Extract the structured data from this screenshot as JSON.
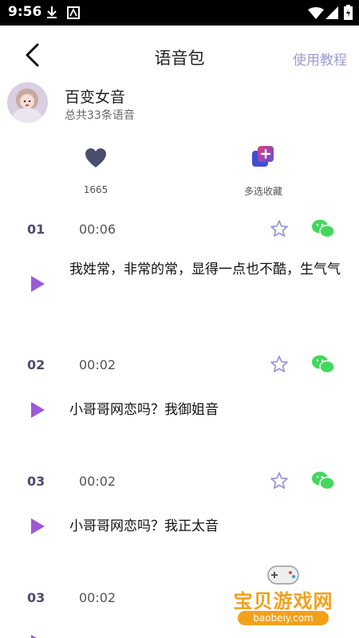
{
  "status_bar": {
    "time": "9:56"
  },
  "app_bar": {
    "title": "语音包",
    "tutorial_link": "使用教程"
  },
  "profile": {
    "name": "百变女音",
    "count_text": "总共33条语音"
  },
  "actions": {
    "likes_count": "1665",
    "multi_collect_label": "多选收藏"
  },
  "items": [
    {
      "number": "01",
      "duration": "00:06",
      "text": "我姓常，非常的常，显得一点也不酷，生气气"
    },
    {
      "number": "02",
      "duration": "00:02",
      "text": "小哥哥网恋吗？我御姐音"
    },
    {
      "number": "03",
      "duration": "00:02",
      "text": "小哥哥网恋吗？我正太音"
    },
    {
      "number": "03",
      "duration": "00:02",
      "text": ""
    }
  ],
  "watermark": {
    "text": "宝贝游戏网",
    "url": "baobeiy.com"
  },
  "colors": {
    "accent": "#9a9bd3",
    "heart": "#4a4d6e",
    "play": "#9b59d6",
    "wechat": "#41d85c",
    "star": "#9a9bd3"
  }
}
